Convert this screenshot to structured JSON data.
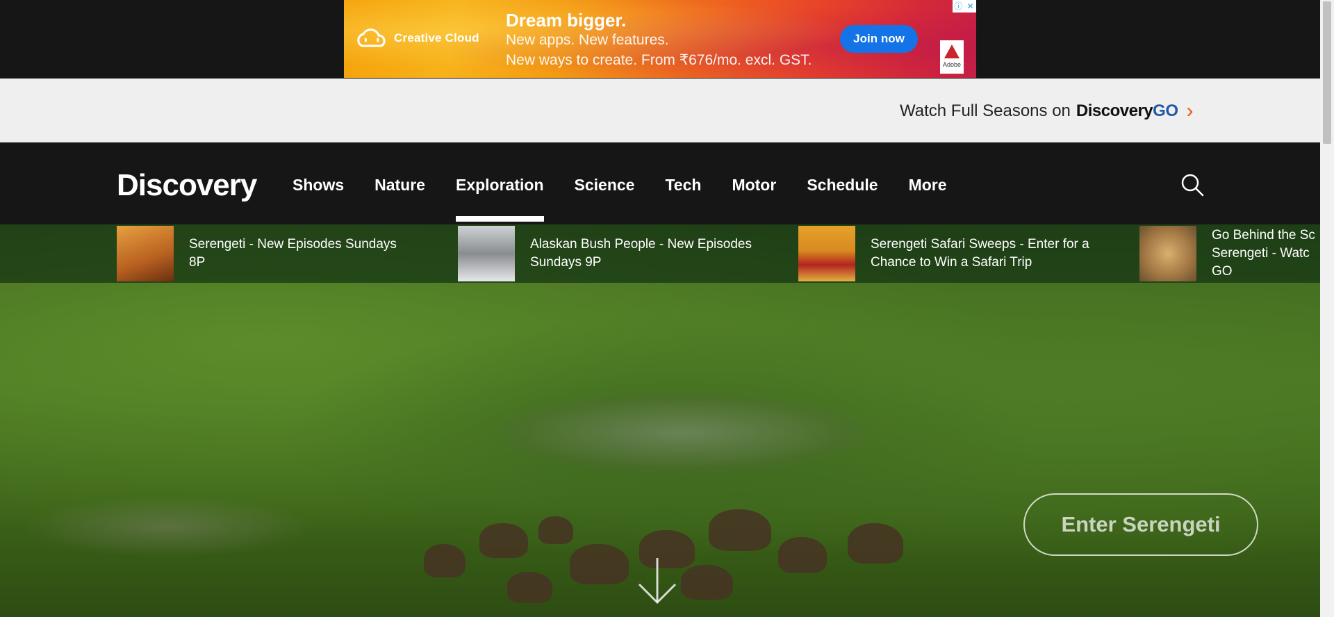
{
  "ad": {
    "brand": "Creative Cloud",
    "headline": "Dream bigger.",
    "line1": "New apps. New features.",
    "line2": "New ways to create. From ₹676/mo. excl. GST.",
    "cta": "Join now",
    "adobe_label": "Adobe",
    "info_icon": "info-icon",
    "close_icon": "close-icon"
  },
  "watch_bar": {
    "text": "Watch Full Seasons on",
    "logo_disc": "Discovery",
    "logo_go": "GO",
    "arrow": "›"
  },
  "nav": {
    "logo": "Discovery",
    "items": [
      {
        "label": "Shows"
      },
      {
        "label": "Nature"
      },
      {
        "label": "Exploration",
        "active": true
      },
      {
        "label": "Science"
      },
      {
        "label": "Tech"
      },
      {
        "label": "Motor"
      },
      {
        "label": "Schedule"
      },
      {
        "label": "More"
      }
    ],
    "search_icon": "search-icon"
  },
  "ticker": [
    {
      "text": "Serengeti - New Episodes Sundays 8P"
    },
    {
      "text": "Alaskan Bush People - New Episodes Sundays 9P"
    },
    {
      "text": "Serengeti Safari Sweeps - Enter for a Chance to Win a Safari Trip"
    },
    {
      "text": "Go Behind the Sc Serengeti - Watc GO"
    }
  ],
  "hero": {
    "cta": "Enter Serengeti",
    "scroll_icon": "arrow-down-icon"
  },
  "colors": {
    "ad_button": "#1473e6",
    "discovery_go_blue": "#1f5aa6",
    "discovery_go_arrow": "#e25a1c"
  }
}
